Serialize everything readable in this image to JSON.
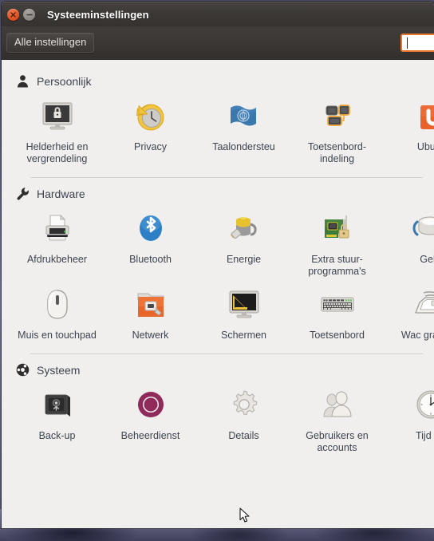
{
  "window": {
    "title": "Systeeminstellingen",
    "close_label": "×",
    "minimize_label": "−"
  },
  "toolbar": {
    "all_settings_label": "Alle instellingen",
    "search_value": "",
    "search_placeholder": ""
  },
  "colors": {
    "titlebar": "#3b3836",
    "close_button": "#df4b1d",
    "minimize_button": "#8b8682",
    "content_bg": "#f0efee",
    "label_text": "#3d4450",
    "focus_border": "#e8762e",
    "ubuntu_orange": "#e8622a",
    "ubuntu_aubergine": "#8f2a5a"
  },
  "sections": [
    {
      "id": "persoonlijk",
      "title": "Persoonlijk",
      "icon": "person-icon",
      "items": [
        {
          "label": "Helderheid en vergrendeling",
          "icon": "monitor-lock-icon"
        },
        {
          "label": "Privacy",
          "icon": "clock-rewind-icon"
        },
        {
          "label": "Taalondersteu",
          "icon": "language-flag-icon"
        },
        {
          "label": "Toetsenbord-indeling",
          "icon": "keyboard-layout-icon"
        },
        {
          "label": "Ubunt",
          "icon": "ubuntu-one-icon"
        }
      ]
    },
    {
      "id": "hardware",
      "title": "Hardware",
      "icon": "wrench-icon",
      "items": [
        {
          "label": "Afdrukbeheer",
          "icon": "printer-icon"
        },
        {
          "label": "Bluetooth",
          "icon": "bluetooth-icon"
        },
        {
          "label": "Energie",
          "icon": "battery-power-icon"
        },
        {
          "label": "Extra stuur-programma's",
          "icon": "driver-card-lock-icon"
        },
        {
          "label": "Gelu",
          "icon": "sound-speaker-icon"
        },
        {
          "label": "Muis en touchpad",
          "icon": "mouse-icon"
        },
        {
          "label": "Netwerk",
          "icon": "network-folder-icon"
        },
        {
          "label": "Schermen",
          "icon": "displays-icon"
        },
        {
          "label": "Toetsenbord",
          "icon": "keyboard-icon"
        },
        {
          "label": "Wac grafi tab",
          "icon": "wacom-tablet-icon"
        }
      ]
    },
    {
      "id": "systeem",
      "title": "Systeem",
      "icon": "ubuntu-circle-icon",
      "items": [
        {
          "label": "Back-up",
          "icon": "safe-vault-icon"
        },
        {
          "label": "Beheerdienst",
          "icon": "landscape-service-icon"
        },
        {
          "label": "Details",
          "icon": "gear-icon"
        },
        {
          "label": "Gebruikers en accounts",
          "icon": "users-icon"
        },
        {
          "label": "Tijd en",
          "icon": "clock-icon"
        }
      ]
    }
  ]
}
